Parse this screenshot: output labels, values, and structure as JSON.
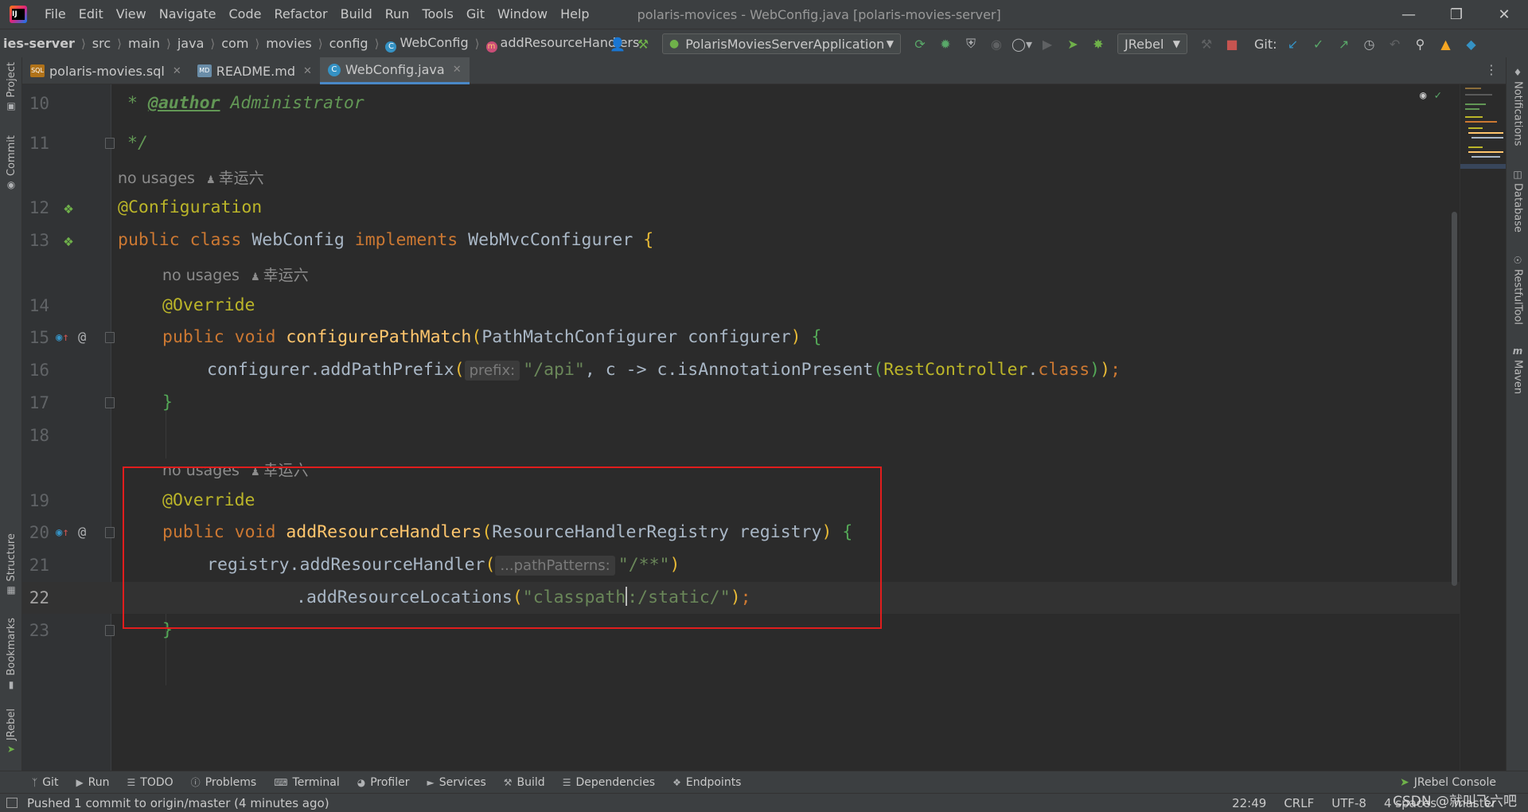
{
  "menu": [
    "File",
    "Edit",
    "View",
    "Navigate",
    "Code",
    "Refactor",
    "Build",
    "Run",
    "Tools",
    "Git",
    "Window",
    "Help"
  ],
  "window_title": "polaris-movices - WebConfig.java [polaris-movies-server]",
  "breadcrumbs": [
    "ies-server",
    "src",
    "main",
    "java",
    "com",
    "movies",
    "config",
    "WebConfig",
    "addResourceHandlers"
  ],
  "toolbar": {
    "run_config": "PolarisMoviesServerApplication",
    "jrebel": "JRebel",
    "git_label": "Git:"
  },
  "tabs": [
    {
      "label": "polaris-movies.sql",
      "icon": "sql-file-icon",
      "icon_text": "SQL"
    },
    {
      "label": "README.md",
      "icon": "markdown-file-icon",
      "icon_text": "MD"
    },
    {
      "label": "WebConfig.java",
      "icon": "java-class-icon",
      "icon_text": "C"
    }
  ],
  "left_tools": [
    "Project",
    "Commit",
    "Structure",
    "Bookmarks",
    "JRebel"
  ],
  "right_tools": [
    "Notifications",
    "Database",
    "RestfulTool",
    "Maven"
  ],
  "hints": {
    "no_usages": "no usages",
    "author": "幸运六",
    "prefix_inlay": "prefix:",
    "path_patterns_inlay": "...pathPatterns:"
  },
  "code": {
    "l10_tag": "@author",
    "l10_text": "Administrator",
    "l10_star": "*",
    "l11": "*/",
    "l12": "@Configuration",
    "l13_public": "public",
    "l13_class": "class",
    "l13_name": "WebConfig",
    "l13_impl": "implements",
    "l13_iface": "WebMvcConfigurer",
    "override": "@Override",
    "l15_method": "configurePathMatch",
    "l15_param": "PathMatchConfigurer configurer",
    "l16_call": "configurer.addPathPrefix",
    "l16_str": "\"/api\"",
    "l16_rest": ", c -> c.isAnnotationPresent",
    "l16_cls": "RestController",
    "l16_class_kw": "class",
    "l20_method": "addResourceHandlers",
    "l20_param": "ResourceHandlerRegistry registry",
    "l21_call": "registry.addResourceHandler",
    "l21_str": "\"/**\"",
    "l22_call": ".addResourceLocations",
    "l22_str_a": "\"classpath",
    "l22_str_b": ":/static/\"",
    "void": "void",
    "public": "public"
  },
  "line_numbers": [
    "10",
    "11",
    "12",
    "13",
    "14",
    "15",
    "16",
    "17",
    "18",
    "19",
    "20",
    "21",
    "22",
    "23"
  ],
  "bottom_tools": [
    "Git",
    "Run",
    "TODO",
    "Problems",
    "Terminal",
    "Profiler",
    "Services",
    "Build",
    "Dependencies",
    "Endpoints"
  ],
  "jrebel_console": "JRebel Console",
  "status": {
    "message": "Pushed 1 commit to origin/master (4 minutes ago)",
    "position": "22:49",
    "line_sep": "CRLF",
    "encoding": "UTF-8",
    "indent": "4 spaces",
    "branch": "master"
  },
  "watermark": "CSDN @就叫飞六吧",
  "colors": {
    "highlight_box": "#e11d1d",
    "accent": "#4a88c7"
  }
}
